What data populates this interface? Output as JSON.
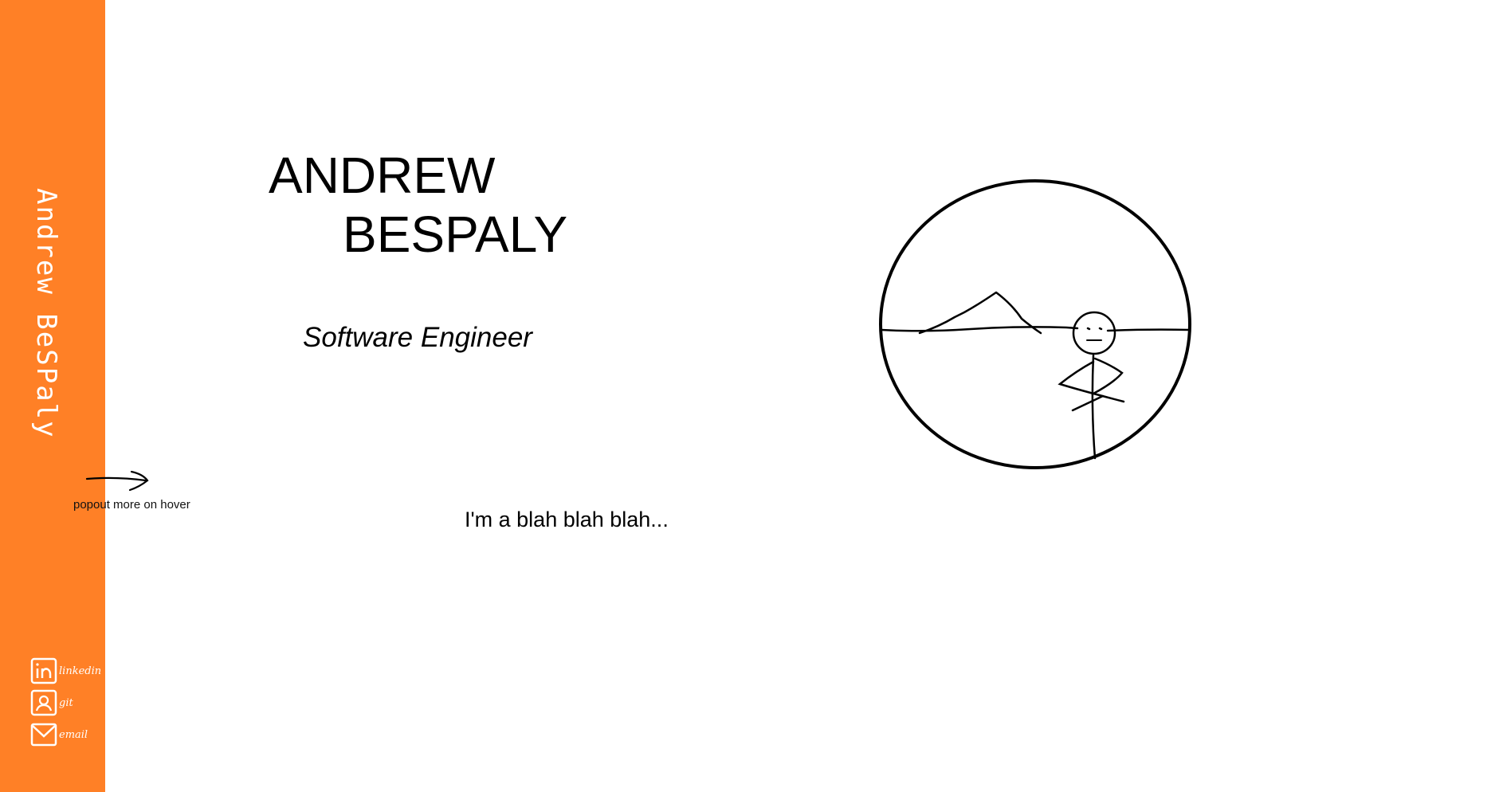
{
  "sidebar": {
    "name": "Andrew BeSPaly",
    "hover_hint": "popout more on hover",
    "links": [
      {
        "label": "linkedin",
        "icon": "linkedin-icon"
      },
      {
        "label": "git",
        "icon": "github-icon"
      },
      {
        "label": "email",
        "icon": "mail-icon"
      }
    ]
  },
  "hero": {
    "name_line1": "ANDREW",
    "name_line2": "BESPALY",
    "subtitle": "Software Engineer",
    "bio": "I'm a blah blah blah..."
  },
  "colors": {
    "sidebar": "#ff8026",
    "text": "#000000",
    "background": "#ffffff"
  }
}
